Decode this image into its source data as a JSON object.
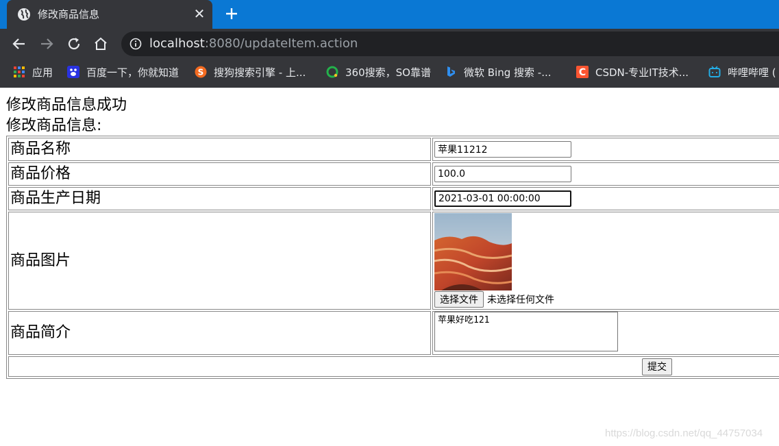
{
  "browser": {
    "tab": {
      "title": "修改商品信息",
      "close": "✕"
    },
    "omnibox": {
      "host": "localhost",
      "rest": ":8080/updateItem.action"
    },
    "bookmarks": [
      {
        "label": "应用",
        "icon": "apps-grid-icon"
      },
      {
        "label": "百度一下，你就知道",
        "icon": "baidu-icon"
      },
      {
        "label": "搜狗搜索引擎 - 上...",
        "icon": "sogou-icon"
      },
      {
        "label": "360搜索，SO靠谱",
        "icon": "360-search-icon"
      },
      {
        "label": "微软 Bing 搜索 -...",
        "icon": "bing-icon"
      },
      {
        "label": "CSDN-专业IT技术...",
        "icon": "csdn-icon"
      },
      {
        "label": "哔哩哔哩 (",
        "icon": "bilibili-icon"
      }
    ],
    "colors": {
      "tabstrip": "#0a78d4",
      "toolbar": "#35363a",
      "omnibox": "#202124"
    }
  },
  "page": {
    "success_message": "修改商品信息成功",
    "form_heading": "修改商品信息:",
    "fields": {
      "name": {
        "label": "商品名称",
        "value": "苹果11212"
      },
      "price": {
        "label": "商品价格",
        "value": "100.0"
      },
      "date": {
        "label": "商品生产日期",
        "value": "2021-03-01 00:00:00"
      },
      "image": {
        "label": "商品图片",
        "choose_button": "选择文件",
        "no_file_text": "未选择任何文件"
      },
      "description": {
        "label": "商品简介",
        "value": "苹果好吃121"
      }
    },
    "submit_label": "提交"
  },
  "watermark": "https://blog.csdn.net/qq_44757034"
}
